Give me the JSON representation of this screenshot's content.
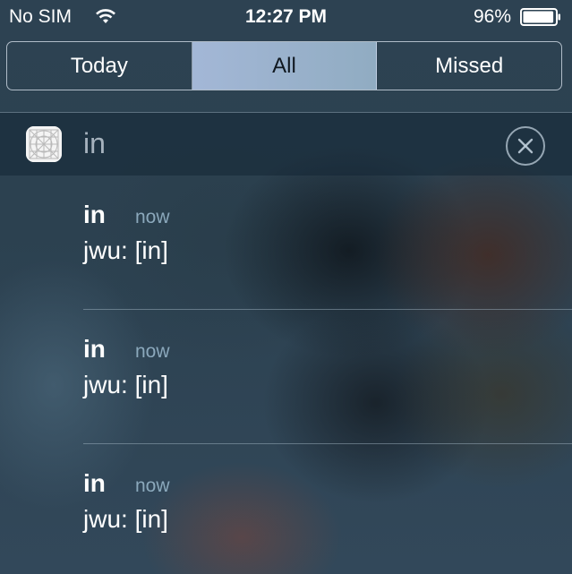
{
  "status_bar": {
    "carrier": "No SIM",
    "time": "12:27 PM",
    "battery_percent": "96%",
    "battery_level": 0.96,
    "wifi_icon": "wifi-icon",
    "battery_icon": "battery-icon"
  },
  "segmented_control": {
    "segments": [
      {
        "label": "Today",
        "selected": false
      },
      {
        "label": "All",
        "selected": true
      },
      {
        "label": "Missed",
        "selected": false
      }
    ]
  },
  "app_group": {
    "app_name": "in",
    "app_icon": "grid-app-icon",
    "clear_icon": "close-circle-icon"
  },
  "notifications": [
    {
      "title": "in",
      "time": "now",
      "body": "jwu: [in]"
    },
    {
      "title": "in",
      "time": "now",
      "body": "jwu: [in]"
    },
    {
      "title": "in",
      "time": "now",
      "body": "jwu: [in]"
    }
  ],
  "colors": {
    "selected_segment": "#a9bed8",
    "timestamp": "#96b4c8",
    "background": "#2d4252"
  }
}
